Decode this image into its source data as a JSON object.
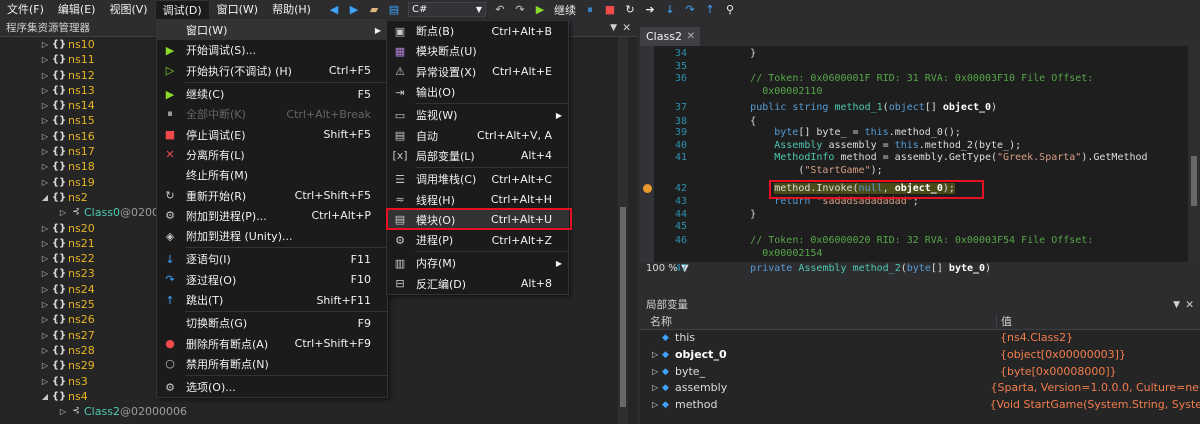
{
  "menubar": {
    "items": [
      "文件(F)",
      "编辑(E)",
      "视图(V)",
      "调试(D)",
      "窗口(W)",
      "帮助(H)"
    ],
    "language": "C#",
    "continue": "继续"
  },
  "assembly_explorer": {
    "title": "程序集资源管理器",
    "rows": [
      {
        "indent": 40,
        "arrow": "▷",
        "icon": "{}",
        "label": "ns10"
      },
      {
        "indent": 40,
        "arrow": "▷",
        "icon": "{}",
        "label": "ns11"
      },
      {
        "indent": 40,
        "arrow": "▷",
        "icon": "{}",
        "label": "ns12"
      },
      {
        "indent": 40,
        "arrow": "▷",
        "icon": "{}",
        "label": "ns13"
      },
      {
        "indent": 40,
        "arrow": "▷",
        "icon": "{}",
        "label": "ns14"
      },
      {
        "indent": 40,
        "arrow": "▷",
        "icon": "{}",
        "label": "ns15"
      },
      {
        "indent": 40,
        "arrow": "▷",
        "icon": "{}",
        "label": "ns16"
      },
      {
        "indent": 40,
        "arrow": "▷",
        "icon": "{}",
        "label": "ns17"
      },
      {
        "indent": 40,
        "arrow": "▷",
        "icon": "{}",
        "label": "ns18"
      },
      {
        "indent": 40,
        "arrow": "▷",
        "icon": "{}",
        "label": "ns19"
      },
      {
        "indent": 40,
        "arrow": "◢",
        "icon": "{}",
        "label": "ns2"
      },
      {
        "indent": 58,
        "arrow": "▷",
        "icon": "cls",
        "label": "Class0",
        "token": " @0200"
      },
      {
        "indent": 40,
        "arrow": "▷",
        "icon": "{}",
        "label": "ns20"
      },
      {
        "indent": 40,
        "arrow": "▷",
        "icon": "{}",
        "label": "ns21"
      },
      {
        "indent": 40,
        "arrow": "▷",
        "icon": "{}",
        "label": "ns22"
      },
      {
        "indent": 40,
        "arrow": "▷",
        "icon": "{}",
        "label": "ns23"
      },
      {
        "indent": 40,
        "arrow": "▷",
        "icon": "{}",
        "label": "ns24"
      },
      {
        "indent": 40,
        "arrow": "▷",
        "icon": "{}",
        "label": "ns25"
      },
      {
        "indent": 40,
        "arrow": "▷",
        "icon": "{}",
        "label": "ns26"
      },
      {
        "indent": 40,
        "arrow": "▷",
        "icon": "{}",
        "label": "ns27"
      },
      {
        "indent": 40,
        "arrow": "▷",
        "icon": "{}",
        "label": "ns28"
      },
      {
        "indent": 40,
        "arrow": "▷",
        "icon": "{}",
        "label": "ns29"
      },
      {
        "indent": 40,
        "arrow": "▷",
        "icon": "{}",
        "label": "ns3"
      },
      {
        "indent": 40,
        "arrow": "◢",
        "icon": "{}",
        "label": "ns4"
      },
      {
        "indent": 58,
        "arrow": "▷",
        "icon": "cls",
        "label": "Class2",
        "token": " @02000006"
      }
    ]
  },
  "debug_menu": {
    "items": [
      {
        "type": "item",
        "icon": "",
        "label": "窗口(W)",
        "shortcut": "",
        "sub": true,
        "hl": true
      },
      {
        "type": "item",
        "icon": "▶",
        "iconClass": "ic-green",
        "label": "开始调试(S)...",
        "shortcut": ""
      },
      {
        "type": "item",
        "icon": "▷",
        "iconClass": "ic-green",
        "label": "开始执行(不调试) (H)",
        "shortcut": "Ctrl+F5"
      },
      {
        "type": "sep"
      },
      {
        "type": "item",
        "icon": "▶",
        "iconClass": "ic-green",
        "label": "继续(C)",
        "shortcut": "F5"
      },
      {
        "type": "item",
        "icon": "⏸",
        "iconClass": "ic-grey",
        "label": "全部中断(K)",
        "shortcut": "Ctrl+Alt+Break",
        "disabled": true
      },
      {
        "type": "item",
        "icon": "■",
        "iconClass": "ic-red",
        "label": "停止调试(E)",
        "shortcut": "Shift+F5"
      },
      {
        "type": "item",
        "icon": "✕",
        "iconClass": "ic-red",
        "label": "分离所有(L)",
        "shortcut": ""
      },
      {
        "type": "item",
        "icon": "",
        "label": "终止所有(M)",
        "shortcut": ""
      },
      {
        "type": "item",
        "icon": "↻",
        "iconClass": "ic-grey",
        "label": "重新开始(R)",
        "shortcut": "Ctrl+Shift+F5"
      },
      {
        "type": "item",
        "icon": "⚙",
        "iconClass": "ic-grey",
        "label": "附加到进程(P)...",
        "shortcut": "Ctrl+Alt+P"
      },
      {
        "type": "item",
        "icon": "◈",
        "iconClass": "ic-grey",
        "label": "附加到进程 (Unity)...",
        "shortcut": ""
      },
      {
        "type": "sep"
      },
      {
        "type": "item",
        "icon": "↓",
        "iconClass": "ic-blue",
        "label": "逐语句(I)",
        "shortcut": "F11"
      },
      {
        "type": "item",
        "icon": "↷",
        "iconClass": "ic-blue",
        "label": "逐过程(O)",
        "shortcut": "F10"
      },
      {
        "type": "item",
        "icon": "↑",
        "iconClass": "ic-blue",
        "label": "跳出(T)",
        "shortcut": "Shift+F11"
      },
      {
        "type": "sep"
      },
      {
        "type": "item",
        "icon": "",
        "label": "切换断点(G)",
        "shortcut": "F9"
      },
      {
        "type": "item",
        "icon": "●",
        "iconClass": "ic-red",
        "label": "删除所有断点(A)",
        "shortcut": "Ctrl+Shift+F9"
      },
      {
        "type": "item",
        "icon": "○",
        "iconClass": "ic-grey",
        "label": "禁用所有断点(N)",
        "shortcut": ""
      },
      {
        "type": "sep"
      },
      {
        "type": "item",
        "icon": "⚙",
        "iconClass": "ic-grey",
        "label": "选项(O)...",
        "shortcut": ""
      }
    ]
  },
  "window_submenu": {
    "items": [
      {
        "icon": "▣",
        "iconClass": "ic-grey",
        "label": "断点(B)",
        "shortcut": "Ctrl+Alt+B"
      },
      {
        "icon": "▦",
        "iconClass": "ic-purple",
        "label": "模块断点(U)",
        "shortcut": ""
      },
      {
        "icon": "⚠",
        "iconClass": "ic-grey",
        "label": "异常设置(X)",
        "shortcut": "Ctrl+Alt+E"
      },
      {
        "icon": "⇥",
        "iconClass": "ic-grey",
        "label": "输出(O)",
        "shortcut": ""
      },
      {
        "type": "sep"
      },
      {
        "icon": "▭",
        "iconClass": "ic-grey",
        "label": "监视(W)",
        "shortcut": "",
        "sub": true
      },
      {
        "icon": "▤",
        "iconClass": "ic-grey",
        "label": "自动",
        "shortcut": "Ctrl+Alt+V, A"
      },
      {
        "icon": "[x]",
        "iconClass": "ic-grey",
        "label": "局部变量(L)",
        "shortcut": "Alt+4"
      },
      {
        "type": "sep"
      },
      {
        "icon": "☰",
        "iconClass": "ic-grey",
        "label": "调用堆栈(C)",
        "shortcut": "Ctrl+Alt+C"
      },
      {
        "icon": "≈",
        "iconClass": "ic-grey",
        "label": "线程(H)",
        "shortcut": "Ctrl+Alt+H"
      },
      {
        "icon": "▤",
        "iconClass": "ic-grey",
        "label": "模块(O)",
        "shortcut": "Ctrl+Alt+U",
        "hl": true
      },
      {
        "icon": "⚙",
        "iconClass": "ic-grey",
        "label": "进程(P)",
        "shortcut": "Ctrl+Alt+Z"
      },
      {
        "type": "sep"
      },
      {
        "icon": "▥",
        "iconClass": "ic-grey",
        "label": "内存(M)",
        "shortcut": "",
        "sub": true
      },
      {
        "icon": "⊟",
        "iconClass": "ic-grey",
        "label": "反汇编(D)",
        "shortcut": "Alt+8"
      }
    ]
  },
  "editor": {
    "tab": "Class2",
    "zoom": "100 %",
    "lines": [
      {
        "n": "34",
        "html": "        <span>}</span>"
      },
      {
        "n": "35",
        "html": ""
      },
      {
        "n": "36",
        "html": "        <span class=\"cm\">// Token: 0x0600001F RID: 31 RVA: 0x00003F10 File Offset:</span>"
      },
      {
        "n": "",
        "html": "        <span class=\"cm\">  0x00002110</span>"
      },
      {
        "n": "37",
        "html": "        <span class=\"kw\">public string</span> <span class=\"ty\">method_1</span>(<span class=\"kw\">object</span>[] <span class=\"bd\">object_0</span>)"
      },
      {
        "n": "38",
        "html": "        {"
      },
      {
        "n": "39",
        "html": "            <span class=\"kw\">byte</span>[] byte_ = <span class=\"kw\">this</span>.method_0();"
      },
      {
        "n": "40",
        "html": "            <span class=\"ty\">Assembly</span> assembly = <span class=\"kw\">this</span>.method_2(byte_);"
      },
      {
        "n": "41",
        "html": "            <span class=\"ty\">MethodInfo</span> method = assembly.GetType(<span class=\"st\">\"Greek.Sparta\"</span>).GetMethod"
      },
      {
        "n": "",
        "html": "                (<span class=\"st\">\"StartGame\"</span>);"
      },
      {
        "n": "42",
        "html": "            <span class=\"hl-line\">method.Invoke(<span class=\"kw\">null</span>, <span class=\"bd\">object_0</span>);</span>",
        "bp": true
      },
      {
        "n": "43",
        "html": "            <span class=\"kw\">return</span> <span class=\"st\">\"sadadsadadadad\"</span>;"
      },
      {
        "n": "44",
        "html": "        }"
      },
      {
        "n": "45",
        "html": ""
      },
      {
        "n": "46",
        "html": "        <span class=\"cm\">// Token: 0x06000020 RID: 32 RVA: 0x00003F54 File Offset:</span>"
      },
      {
        "n": "",
        "html": "        <span class=\"cm\">  0x00002154</span>"
      },
      {
        "n": "47",
        "html": "        <span class=\"kw\">private</span> <span class=\"ty\">Assembly</span> <span class=\"ty\">method_2</span>(<span class=\"kw\">byte</span>[] <span class=\"bd\">byte_0</span>)"
      }
    ]
  },
  "locals": {
    "title": "局部变量",
    "col_name": "名称",
    "col_value": "值",
    "rows": [
      {
        "expand": false,
        "name": "this",
        "value": "{ns4.Class2}",
        "bold": false
      },
      {
        "expand": true,
        "name": "object_0",
        "value": "{object[0x00000003]}",
        "bold": true
      },
      {
        "expand": true,
        "name": "byte_",
        "value": "{byte[0x00008000]}",
        "bold": false
      },
      {
        "expand": true,
        "name": "assembly",
        "value": "{Sparta, Version=1.0.0.0, Culture=neu",
        "bold": false
      },
      {
        "expand": true,
        "name": "method",
        "value": "{Void StartGame(System.String, Syster",
        "bold": false
      }
    ]
  }
}
